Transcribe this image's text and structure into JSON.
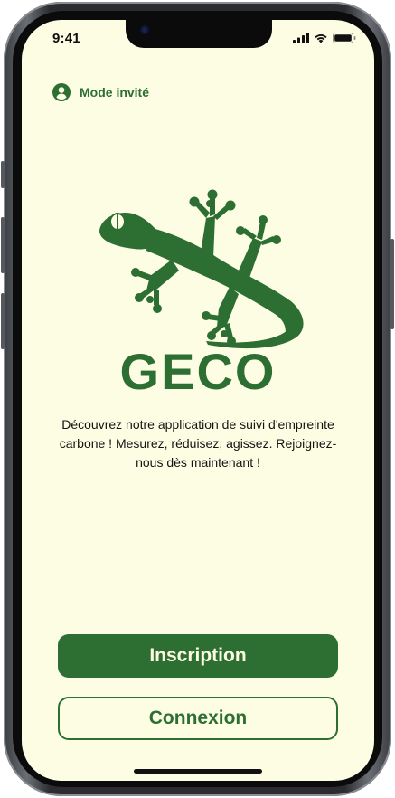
{
  "status_bar": {
    "time": "9:41",
    "icons": [
      "signal-icon",
      "wifi-icon",
      "battery-icon"
    ]
  },
  "guest": {
    "icon": "user-circle-icon",
    "label": "Mode invité"
  },
  "logo": {
    "icon": "gecko-logo",
    "wordmark": "GECO"
  },
  "tagline": "Découvrez notre application de suivi d'empreinte carbone ! Mesurez, réduisez, agissez. Rejoignez-nous dès maintenant !",
  "actions": {
    "signup_label": "Inscription",
    "login_label": "Connexion"
  },
  "colors": {
    "brand_green": "#2d6e32",
    "background": "#fdfde3",
    "text": "#141414"
  }
}
